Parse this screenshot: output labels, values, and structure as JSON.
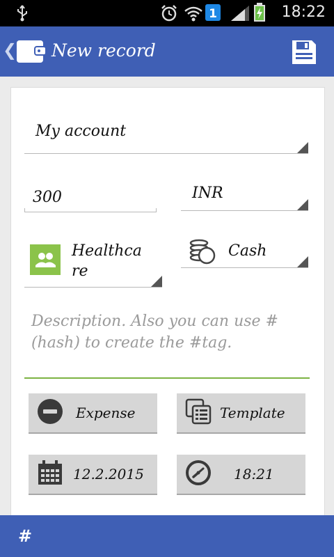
{
  "status_bar": {
    "time": "18:22",
    "notification_count": "1"
  },
  "app_bar": {
    "title": "New record"
  },
  "form": {
    "account": "My account",
    "amount": "300",
    "currency": "INR",
    "category_line1": "Healthca",
    "category_line2": "re",
    "payment_type": "Cash",
    "description_placeholder": "Description. Also you can use # (hash) to create the #tag.",
    "expense_label": "Expense",
    "template_label": "Template",
    "date": "12.2.2015",
    "time": "18:21"
  },
  "bottom_bar": {
    "hashtag_label": "#"
  },
  "colors": {
    "primary": "#3f5fb5",
    "accent_green": "#7cb342",
    "category_green": "#8bc34a"
  }
}
